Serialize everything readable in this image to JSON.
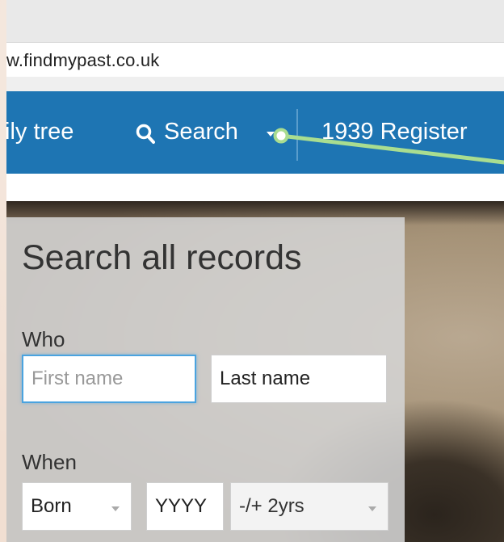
{
  "browser": {
    "url": "w.findmypast.co.uk"
  },
  "nav": {
    "items": [
      {
        "label": "ily tree"
      },
      {
        "label": "Search"
      },
      {
        "label": "1939 Register"
      }
    ]
  },
  "search_panel": {
    "title": "Search all records",
    "who_label": "Who",
    "first_name_placeholder": "First name",
    "last_name_value": "Last name",
    "when_label": "When",
    "event_select": "Born",
    "year_value": "YYYY",
    "range_select": "-/+ 2yrs"
  },
  "colors": {
    "nav_blue": "#1e75b3",
    "callout_green": "#a9dd90",
    "focus_blue": "#4aa3df"
  }
}
